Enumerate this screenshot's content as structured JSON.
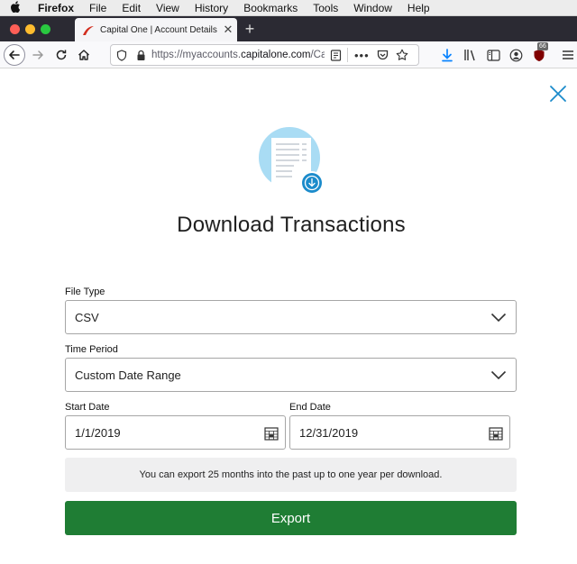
{
  "menubar": {
    "app_name": "Firefox",
    "items": [
      "File",
      "Edit",
      "View",
      "History",
      "Bookmarks",
      "Tools",
      "Window",
      "Help"
    ]
  },
  "browser": {
    "tab_title": "Capital One | Account Details",
    "url_prefix": "https://myaccounts.",
    "url_domain": "capitalone.com",
    "url_suffix": "/Ca",
    "ublock_count": "66"
  },
  "dialog": {
    "title": "Download Transactions",
    "file_type": {
      "label": "File Type",
      "value": "CSV"
    },
    "time_period": {
      "label": "Time Period",
      "value": "Custom Date Range"
    },
    "start_date": {
      "label": "Start Date",
      "value": "1/1/2019"
    },
    "end_date": {
      "label": "End Date",
      "value": "12/31/2019"
    },
    "info_text": "You can export 25 months into the past up to one year per download.",
    "export_label": "Export"
  },
  "colors": {
    "export_button": "#1f7d34",
    "accent_blue": "#1b8bcb",
    "hero_circle": "#a9dcf4"
  }
}
